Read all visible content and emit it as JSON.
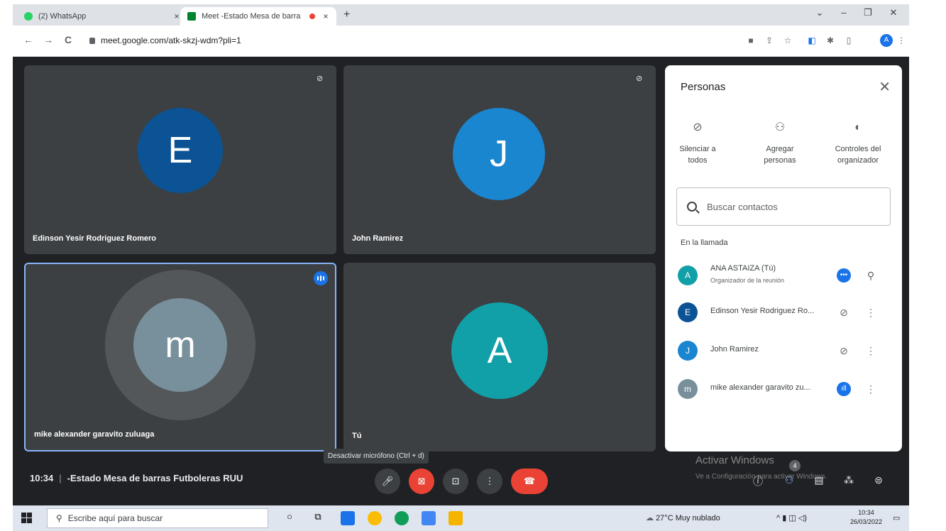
{
  "browser": {
    "tabs": [
      {
        "title": "(2) WhatsApp",
        "close": "×"
      },
      {
        "title": "Meet -Estado Mesa de barra",
        "close": "×"
      }
    ],
    "new_tab": "+",
    "window_controls": {
      "chevron": "⌄",
      "minimize": "–",
      "restore": "❐",
      "close": "✕"
    },
    "nav": {
      "back": "←",
      "forward": "→",
      "reload": "C"
    },
    "url": "meet.google.com/atk-skzj-wdm?pli=1",
    "profile_initial": "A"
  },
  "tiles": [
    {
      "name": "Edinson Yesir Rodriguez Romero",
      "initial": "E",
      "color": "#0b5394"
    },
    {
      "name": "John Ramirez",
      "initial": "J",
      "color": "#1a86d0"
    },
    {
      "name": "mike alexander garavito zuluaga",
      "initial": "m",
      "color": "#78909c"
    },
    {
      "name": "Tú",
      "initial": "A",
      "color": "#12a0a8"
    }
  ],
  "people_panel": {
    "title": "Personas",
    "close": "✕",
    "actions": [
      {
        "label_line1": "Silenciar a",
        "label_line2": "todos"
      },
      {
        "label_line1": "Agregar",
        "label_line2": "personas"
      },
      {
        "label_line1": "Controles del",
        "label_line2": "organizador"
      }
    ],
    "search_placeholder": "Buscar contactos",
    "section_label": "En la llamada",
    "participants": [
      {
        "initial": "A",
        "name": "ANA ASTAIZA (Tú)",
        "subtitle": "Organizador de la reunión",
        "color": "#12a0a8"
      },
      {
        "initial": "E",
        "name": "Edinson Yesir Rodriguez Ro...",
        "color": "#0b5394"
      },
      {
        "initial": "J",
        "name": "John Ramirez",
        "color": "#1a86d0"
      },
      {
        "initial": "m",
        "name": "mike alexander garavito zu...",
        "color": "#78909c"
      }
    ]
  },
  "meeting": {
    "time": "10:34",
    "title": "-Estado Mesa de barras Futboleras RUU",
    "tooltip": "Desactivar micrófono (Ctrl + d)",
    "people_count": "4"
  },
  "watermark": {
    "line1": "Activar Windows",
    "line2": "Ve a Configuración para activar Windows."
  },
  "taskbar": {
    "search_placeholder": "Escribe aquí para buscar",
    "weather": "27°C  Muy nublado",
    "time": "10:34",
    "date": "26/03/2022"
  },
  "colors": {
    "meet_bg": "#202124",
    "tile_bg": "#3c4043",
    "accent_blue": "#1a73e8",
    "danger_red": "#ea4335"
  }
}
